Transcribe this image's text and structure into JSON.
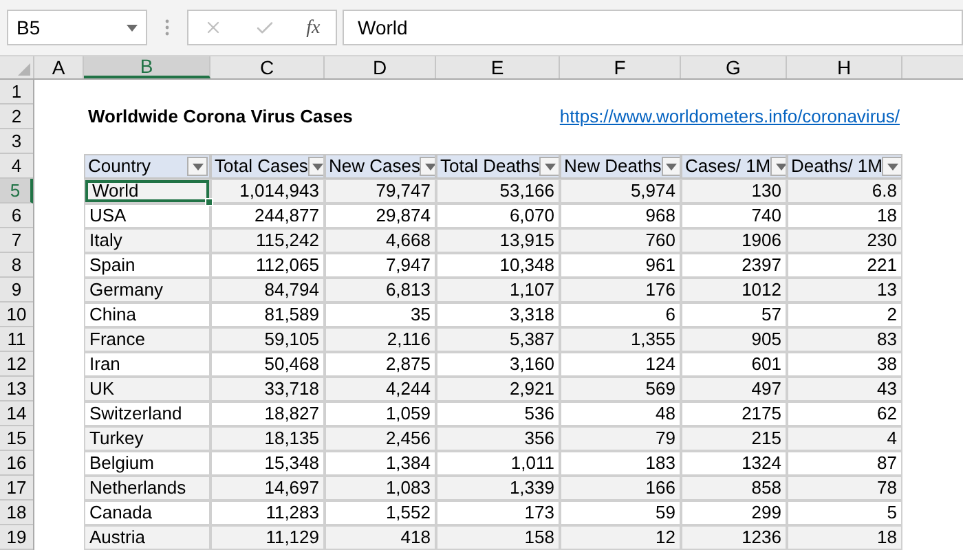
{
  "formula_bar": {
    "name_box": "B5",
    "function_label": "fx",
    "formula": "World"
  },
  "column_headers": [
    {
      "label": "A",
      "selected": false
    },
    {
      "label": "B",
      "selected": true
    },
    {
      "label": "C",
      "selected": false
    },
    {
      "label": "D",
      "selected": false
    },
    {
      "label": "E",
      "selected": false
    },
    {
      "label": "F",
      "selected": false
    },
    {
      "label": "G",
      "selected": false
    },
    {
      "label": "H",
      "selected": false
    }
  ],
  "row_headers": [
    {
      "label": "1",
      "selected": false
    },
    {
      "label": "2",
      "selected": false
    },
    {
      "label": "3",
      "selected": false
    },
    {
      "label": "4",
      "selected": false
    },
    {
      "label": "5",
      "selected": true
    },
    {
      "label": "6",
      "selected": false
    },
    {
      "label": "7",
      "selected": false
    },
    {
      "label": "8",
      "selected": false
    },
    {
      "label": "9",
      "selected": false
    },
    {
      "label": "10",
      "selected": false
    },
    {
      "label": "11",
      "selected": false
    },
    {
      "label": "12",
      "selected": false
    },
    {
      "label": "13",
      "selected": false
    },
    {
      "label": "14",
      "selected": false
    },
    {
      "label": "15",
      "selected": false
    },
    {
      "label": "16",
      "selected": false
    },
    {
      "label": "17",
      "selected": false
    },
    {
      "label": "18",
      "selected": false
    },
    {
      "label": "19",
      "selected": false
    }
  ],
  "title": "Worldwide Corona Virus Cases",
  "link": "https://www.worldometers.info/coronavirus/",
  "table": {
    "columns": [
      "Country",
      "Total Cases",
      "New Cases",
      "Total Deaths",
      "New Deaths",
      "Cases/ 1M",
      "Deaths/ 1M"
    ],
    "rows": [
      {
        "selected": true,
        "cells": [
          "World",
          "1,014,943",
          "79,747",
          "53,166",
          "5,974",
          "130",
          "6.8"
        ]
      },
      {
        "selected": false,
        "cells": [
          "USA",
          "244,877",
          "29,874",
          "6,070",
          "968",
          "740",
          "18"
        ]
      },
      {
        "selected": false,
        "cells": [
          "Italy",
          "115,242",
          "4,668",
          "13,915",
          "760",
          "1906",
          "230"
        ]
      },
      {
        "selected": false,
        "cells": [
          "Spain",
          "112,065",
          "7,947",
          "10,348",
          "961",
          "2397",
          "221"
        ]
      },
      {
        "selected": false,
        "cells": [
          "Germany",
          "84,794",
          "6,813",
          "1,107",
          "176",
          "1012",
          "13"
        ]
      },
      {
        "selected": false,
        "cells": [
          "China",
          "81,589",
          "35",
          "3,318",
          "6",
          "57",
          "2"
        ]
      },
      {
        "selected": false,
        "cells": [
          "France",
          "59,105",
          "2,116",
          "5,387",
          "1,355",
          "905",
          "83"
        ]
      },
      {
        "selected": false,
        "cells": [
          "Iran",
          "50,468",
          "2,875",
          "3,160",
          "124",
          "601",
          "38"
        ]
      },
      {
        "selected": false,
        "cells": [
          "UK",
          "33,718",
          "4,244",
          "2,921",
          "569",
          "497",
          "43"
        ]
      },
      {
        "selected": false,
        "cells": [
          "Switzerland",
          "18,827",
          "1,059",
          "536",
          "48",
          "2175",
          "62"
        ]
      },
      {
        "selected": false,
        "cells": [
          "Turkey",
          "18,135",
          "2,456",
          "356",
          "79",
          "215",
          "4"
        ]
      },
      {
        "selected": false,
        "cells": [
          "Belgium",
          "15,348",
          "1,384",
          "1,011",
          "183",
          "1324",
          "87"
        ]
      },
      {
        "selected": false,
        "cells": [
          "Netherlands",
          "14,697",
          "1,083",
          "1,339",
          "166",
          "858",
          "78"
        ]
      },
      {
        "selected": false,
        "cells": [
          "Canada",
          "11,283",
          "1,552",
          "173",
          "59",
          "299",
          "5"
        ]
      },
      {
        "selected": false,
        "cells": [
          "Austria",
          "11,129",
          "418",
          "158",
          "12",
          "1236",
          "18"
        ]
      }
    ]
  }
}
